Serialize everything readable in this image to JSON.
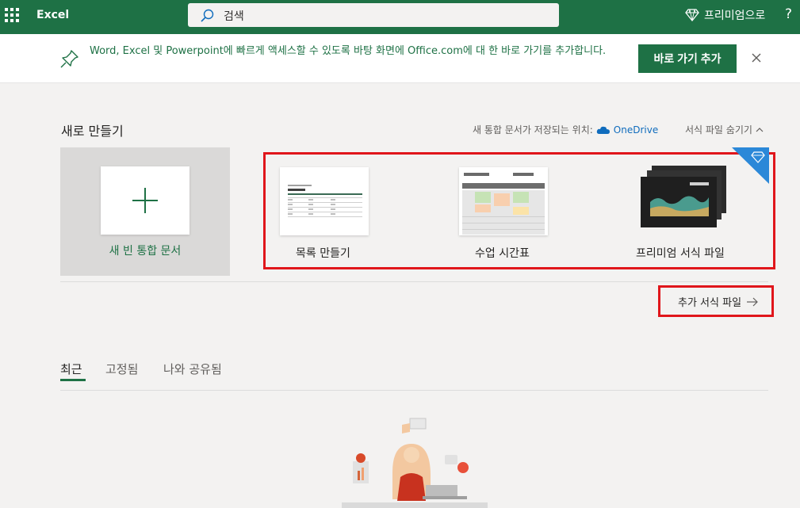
{
  "topbar": {
    "app_name": "Excel",
    "search_placeholder": "검색",
    "premium_label": "프리미엄으로",
    "help_label": "?"
  },
  "banner": {
    "message": "Word, Excel 및 Powerpoint에 빠르게 액세스할 수 있도록 바탕 화면에 Office.com에 대 한 바로 가기를 추가합니다.",
    "button_label": "바로 가기 추가"
  },
  "new_section": {
    "title": "새로 만들기",
    "save_location_label": "새 통합 문서가 저장되는 위치:",
    "save_location_service": "OneDrive",
    "hide_templates_label": "서식 파일 숨기기",
    "blank_label": "새 빈 통합 문서",
    "templates": [
      {
        "label": "목록 만들기"
      },
      {
        "label": "수업 시간표"
      },
      {
        "label": "프리미엄 서식 파일"
      }
    ],
    "more_templates_label": "추가 서식 파일"
  },
  "recent_tabs": [
    {
      "label": "최근",
      "active": true
    },
    {
      "label": "고정됨",
      "active": false
    },
    {
      "label": "나와 공유됨",
      "active": false
    }
  ],
  "colors": {
    "brand_green": "#1e7145",
    "highlight_red": "#e0161b",
    "premium_badge": "#2b88d8"
  }
}
